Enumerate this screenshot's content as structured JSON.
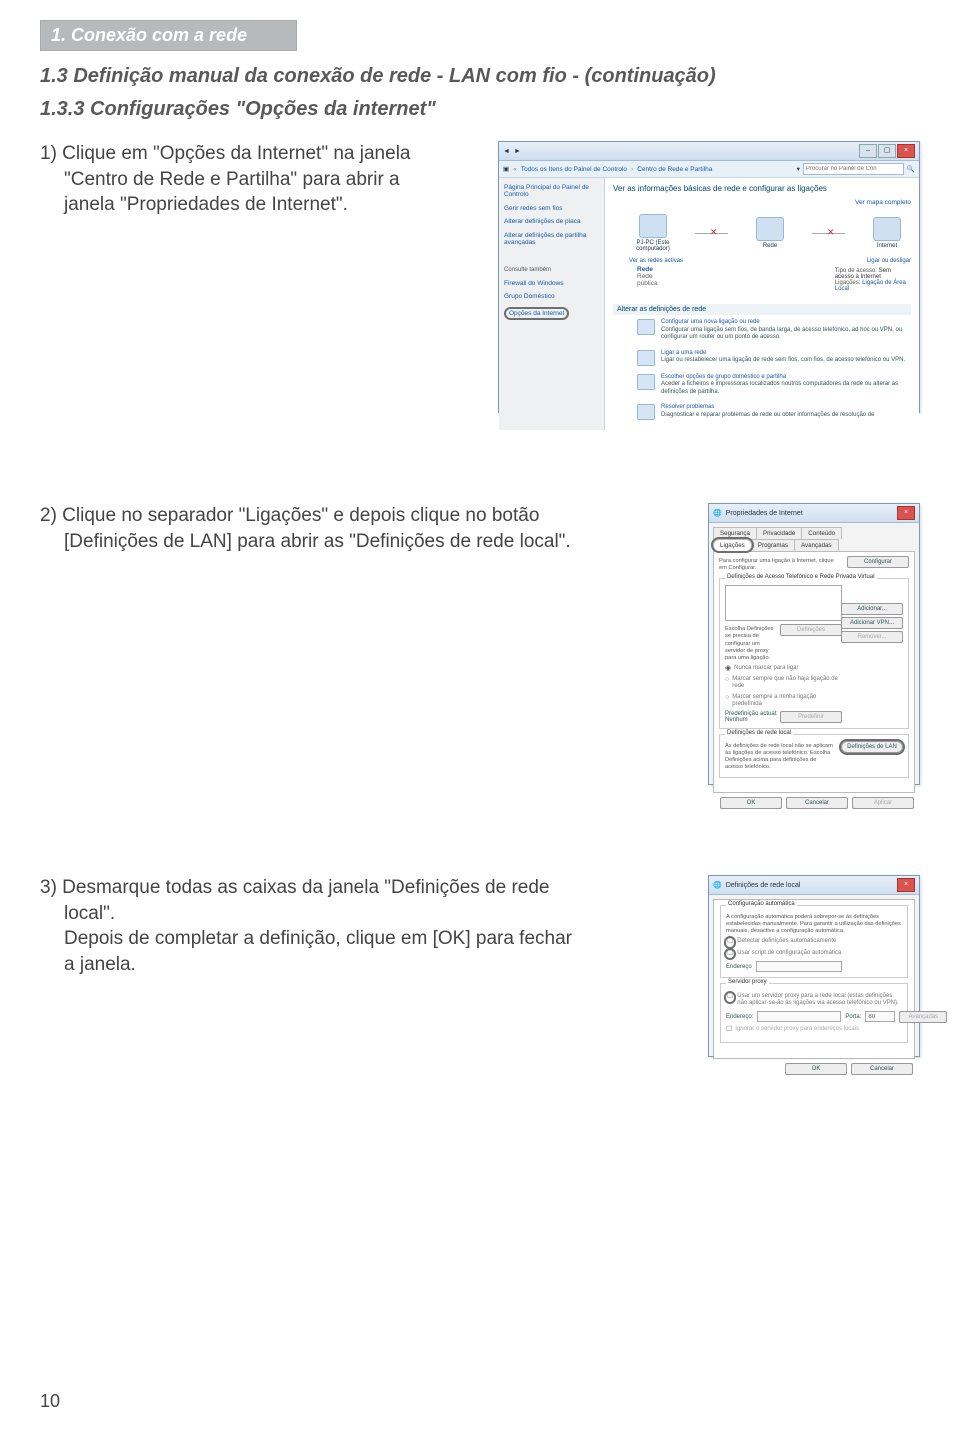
{
  "header_bar": "1. Conexão com a rede",
  "subtitle": "1.3 Definição manual da conexão de rede - LAN com fio - (continuação)",
  "section_title": "1.3.3 Configurações \"Opções da internet\"",
  "step1": {
    "lead": "1) Clique em \"Opções da Internet\" na janela",
    "line2": "\"Centro de Rede e Partilha\" para abrir a",
    "line3": "janela \"Propriedades de Internet\"."
  },
  "step2": {
    "lead": "2) Clique no separador \"Ligações\" e depois clique no botão",
    "line2": "[Definições de LAN] para abrir as \"Definições de rede local\"."
  },
  "step3": {
    "lead": "3) Desmarque todas as caixas da janela \"Definições de rede",
    "line2": "local\".",
    "line3": "Depois de completar a definição, clique em [OK] para fechar",
    "line4": "a janela."
  },
  "page_number": "10",
  "mock1": {
    "breadcrumb": {
      "root": "Todos os Itens do Painel de Controlo",
      "current": "Centro de Rede e Partilha"
    },
    "search_placeholder": "Procurar no Painel de Con",
    "sidebar": {
      "main_link": "Página Principal do Painel de Controlo",
      "items": [
        "Gerir redes sem fios",
        "Alterar definições de placa",
        "Alterar definições de partilha avançadas"
      ],
      "see_also_label": "Consulte também",
      "see_also": [
        "Firewall do Windows",
        "Grupo Doméstico"
      ],
      "circled": "Opções da Internet"
    },
    "main_heading": "Ver as informações básicas de rede e configurar as ligações",
    "map_link": "Ver mapa completo",
    "nodes": {
      "n1": "PJ-PC\n(Este computador)",
      "n2": "Rede",
      "n3": "Internet"
    },
    "active_label": "Ver as redes activas",
    "connect_link": "Ligar ou desligar",
    "status": {
      "network_name": "Rede",
      "network_type": "Rede pública",
      "col1_label": "Tipo de acesso:",
      "col1_val": "Sem acesso à Internet",
      "col2_label": "Ligações:",
      "col2_val": "Ligação de Área Local"
    },
    "section_change": "Alterar as definições de rede",
    "actions": [
      {
        "title": "Configurar uma nova ligação ou rede",
        "desc": "Configurar uma ligação sem fios, de banda larga, de acesso telefónico, ad hoc ou VPN, ou configurar um router ou um ponto de acesso."
      },
      {
        "title": "Ligar a uma rede",
        "desc": "Ligar ou restabelecer uma ligação de rede sem fios, com fios, de acesso telefónico ou VPN."
      },
      {
        "title": "Escolher opções de grupo doméstico e partilha",
        "desc": "Aceder a ficheiros e impressoras localizados noutros computadores da rede ou alterar as definições de partilha."
      },
      {
        "title": "Resolver problemas",
        "desc": "Diagnosticar e reparar problemas de rede ou obter informações de resolução de"
      }
    ]
  },
  "mock2": {
    "title": "Propriedades de Internet",
    "tabs_row1": [
      "Segurança",
      "Privacidade",
      "Conteúdo"
    ],
    "tabs_row2": [
      "Ligações",
      "Programas",
      "Avançadas"
    ],
    "dialup_label": "Definições de Acesso Telefónico e Rede Privada Virtual",
    "config_note": "Para configurar uma ligação à Internet, clique em Configurar.",
    "config_btn": "Configurar",
    "btns": [
      "Adicionar...",
      "Adicionar VPN...",
      "Remover..."
    ],
    "proxy_note": "Escolha Definições se precisa de configurar um servidor de proxy para uma ligação.",
    "proxy_btn": "Definições",
    "radios": [
      "Nunca marcar para ligar",
      "Marcar sempre que não haja ligação de rede",
      "Marcar sempre a minha ligação predefinida"
    ],
    "predef_label": "Predefinição actual:",
    "predef_val": "Nenhum",
    "predef_btn": "Predefinir",
    "lan_group": "Definições de rede local",
    "lan_note": "As definições de rede local não se aplicam às ligações de acesso telefónico. Escolha Definições acima para definições de acesso telefónico.",
    "lan_btn": "Definições de LAN",
    "bottom": [
      "OK",
      "Cancelar",
      "Aplicar"
    ]
  },
  "mock3": {
    "title": "Definições de rede local",
    "group1": "Configuração automática",
    "g1_note": "A configuração automática poderá sobrepor-se às definições estabelecidas manualmente. Para garantir a utilização das definições manuais, desactive a configuração automática.",
    "chk1": "Detectar definições automaticamente",
    "chk2": "Usar script de configuração automática",
    "addr_label": "Endereço",
    "group2": "Servidor proxy",
    "chk3": "Usar um servidor proxy para a rede local (estas definições não aplicar-se-ão às ligações via acesso telefónico ou VPN).",
    "addr2_label": "Endereço:",
    "port_label": "Porta:",
    "port_val": "80",
    "adv_btn": "Avançadas",
    "chk4": "Ignorar o servidor proxy para endereços locais",
    "bottom": [
      "OK",
      "Cancelar"
    ]
  }
}
